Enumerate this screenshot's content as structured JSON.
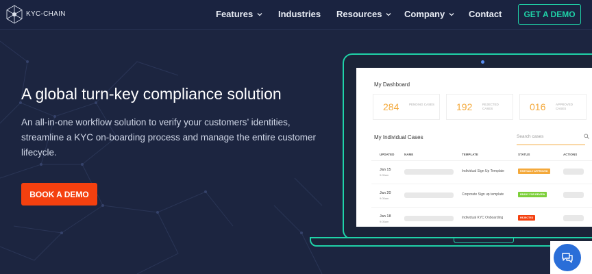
{
  "brand": {
    "name": "KYC-CHAIN"
  },
  "nav": {
    "items": [
      {
        "label": "Features",
        "dropdown": true
      },
      {
        "label": "Industries",
        "dropdown": false
      },
      {
        "label": "Resources",
        "dropdown": true
      },
      {
        "label": "Company",
        "dropdown": true
      },
      {
        "label": "Contact",
        "dropdown": false
      }
    ],
    "cta_label": "GET A DEMO"
  },
  "hero": {
    "title": "A global turn-key compliance solution",
    "subtitle": "An all-in-one workflow solution to verify your customers’ identities, streamline a KYC on-boarding process and manage the entire customer lifecycle.",
    "button_label": "BOOK A DEMO"
  },
  "dashboard": {
    "title": "My Dashboard",
    "stats": [
      {
        "value": "284",
        "label": "PENDING CASES"
      },
      {
        "value": "192",
        "label": "REJECTED CASES"
      },
      {
        "value": "016",
        "label": "APPROVED CASES"
      }
    ],
    "cases_title": "My Individual Cases",
    "search_placeholder": "Search cases",
    "columns": [
      "UPDATED",
      "NAME",
      "TEMPLATE",
      "STATUS",
      "ACTIONS"
    ],
    "rows": [
      {
        "date": "Jan 15",
        "time": "9:05am",
        "template": "Individual Sign Up Template",
        "status": "PARTIALLY APPROVED",
        "status_color": "#f4a93b"
      },
      {
        "date": "Jan 20",
        "time": "9:05am",
        "template": "Corporate Sign up template",
        "status": "READY FOR REVIEW",
        "status_color": "#7ccf3a"
      },
      {
        "date": "Jan 18",
        "time": "9:05am",
        "template": "Individual KYC Onboarding",
        "status": "REJECTED",
        "status_color": "#f4400f"
      }
    ]
  },
  "colors": {
    "accent": "#1fd3a8",
    "cta": "#f4400f",
    "background": "#1c2540",
    "chat": "#2a6ed8"
  },
  "icons": {
    "logo": "network-hexagon-icon",
    "chevron": "chevron-down-icon",
    "search": "search-icon",
    "chat": "chat-bubble-icon"
  }
}
